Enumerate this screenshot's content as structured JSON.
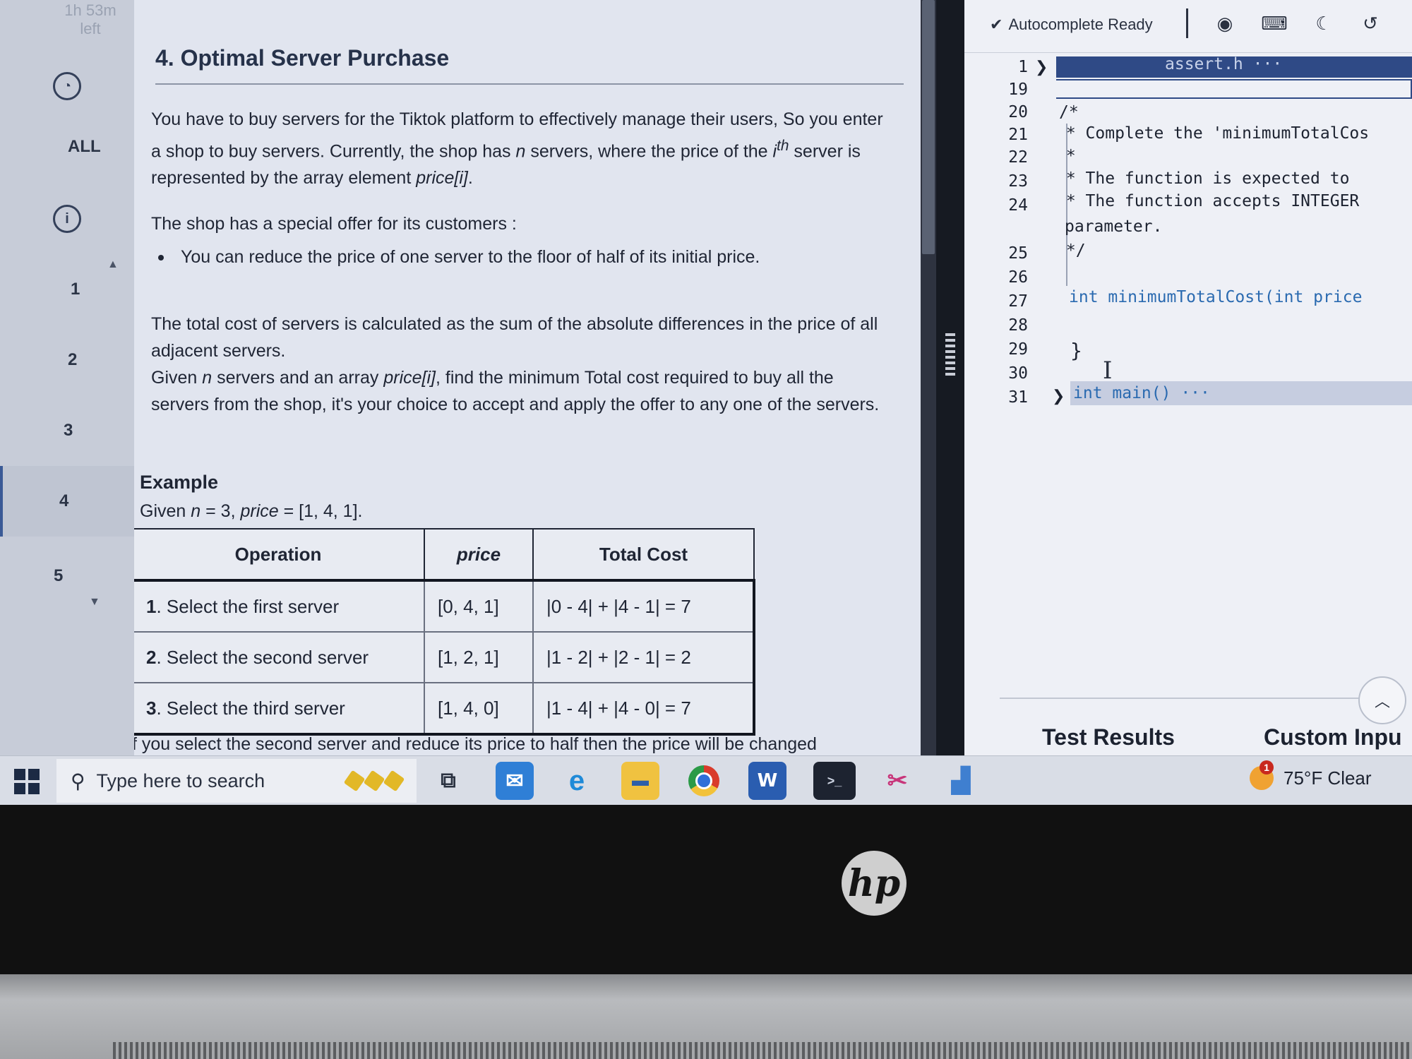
{
  "rail": {
    "timer_line1": "1h 53m",
    "timer_line2": "left",
    "all_label": "ALL",
    "questions": [
      "1",
      "2",
      "3",
      "4",
      "5"
    ],
    "active_question": "4"
  },
  "problem": {
    "title": "4. Optimal Server Purchase",
    "p1_a": "You have to buy servers for the Tiktok platform to effectively manage their users, So you enter a shop to buy servers. Currently, the shop has ",
    "p1_n": "n",
    "p1_b": " servers, where the price of the ",
    "p1_i": "i",
    "p1_th": "th",
    "p1_c": " server is represented by the array element ",
    "p1_price": "price[i]",
    "p1_end": ".",
    "offer_intro": "The shop has a special offer for its customers :",
    "offer_bullet": "You can reduce the price of one server to the floor of half of its initial price.",
    "p2": "The total cost of servers is calculated as the sum of the absolute differences in the price of all adjacent servers.",
    "p3_a": "Given ",
    "p3_n": "n",
    "p3_b": " servers and an array ",
    "p3_price": "price[i]",
    "p3_c": ", find the minimum Total cost required to buy all the servers from the shop, it's your choice to accept and apply the offer to any one of the servers.",
    "example_heading": "Example",
    "given_a": "Given ",
    "given_n": "n",
    "given_b": " = 3, ",
    "given_price": "price",
    "given_c": " = [1, 4, 1].",
    "table": {
      "headers": [
        "Operation",
        "price",
        "Total Cost"
      ],
      "rows": [
        {
          "num": "1",
          "op": ". Select the first server",
          "price": "[0, 4, 1]",
          "cost": "|0 - 4| + |4 - 1| = 7"
        },
        {
          "num": "2",
          "op": ". Select the second server",
          "price": "[1, 2, 1]",
          "cost": "|1 - 2| + |2 - 1| = 2"
        },
        {
          "num": "3",
          "op": ". Select the third server",
          "price": "[1, 4, 0]",
          "cost": "|1 - 4| + |4 - 0| = 7"
        }
      ]
    },
    "cut_text": "If you select the second server and reduce its price to half then the price will be changed"
  },
  "editor": {
    "autocomplete": "Autocomplete Ready",
    "lines": [
      {
        "n": "1",
        "text": "assert.h ···",
        "fold": true
      },
      {
        "n": "19",
        "text": ""
      },
      {
        "n": "20",
        "text": "/*"
      },
      {
        "n": "21",
        "text": " * Complete the 'minimumTotalCos"
      },
      {
        "n": "22",
        "text": " *"
      },
      {
        "n": "23",
        "text": " * The function is expected to"
      },
      {
        "n": "24",
        "text": " * The function accepts INTEGER"
      },
      {
        "n": "",
        "text": "parameter."
      },
      {
        "n": "25",
        "text": " */"
      },
      {
        "n": "26",
        "text": ""
      },
      {
        "n": "27",
        "text": "int minimumTotalCost(int price"
      },
      {
        "n": "28",
        "text": ""
      },
      {
        "n": "29",
        "text": "}"
      },
      {
        "n": "30",
        "text": ""
      },
      {
        "n": "31",
        "text": "int main() ···",
        "fold": true
      }
    ],
    "tab_results": "Test Results",
    "tab_custom": "Custom Inpu"
  },
  "taskbar": {
    "search_placeholder": "Type here to search",
    "weather": "75°F  Clear",
    "weather_badge": "1",
    "word_letter": "W"
  },
  "brand": "hp",
  "colors": {
    "accent": "#2f4a86",
    "keyword": "#2a6ab0"
  }
}
